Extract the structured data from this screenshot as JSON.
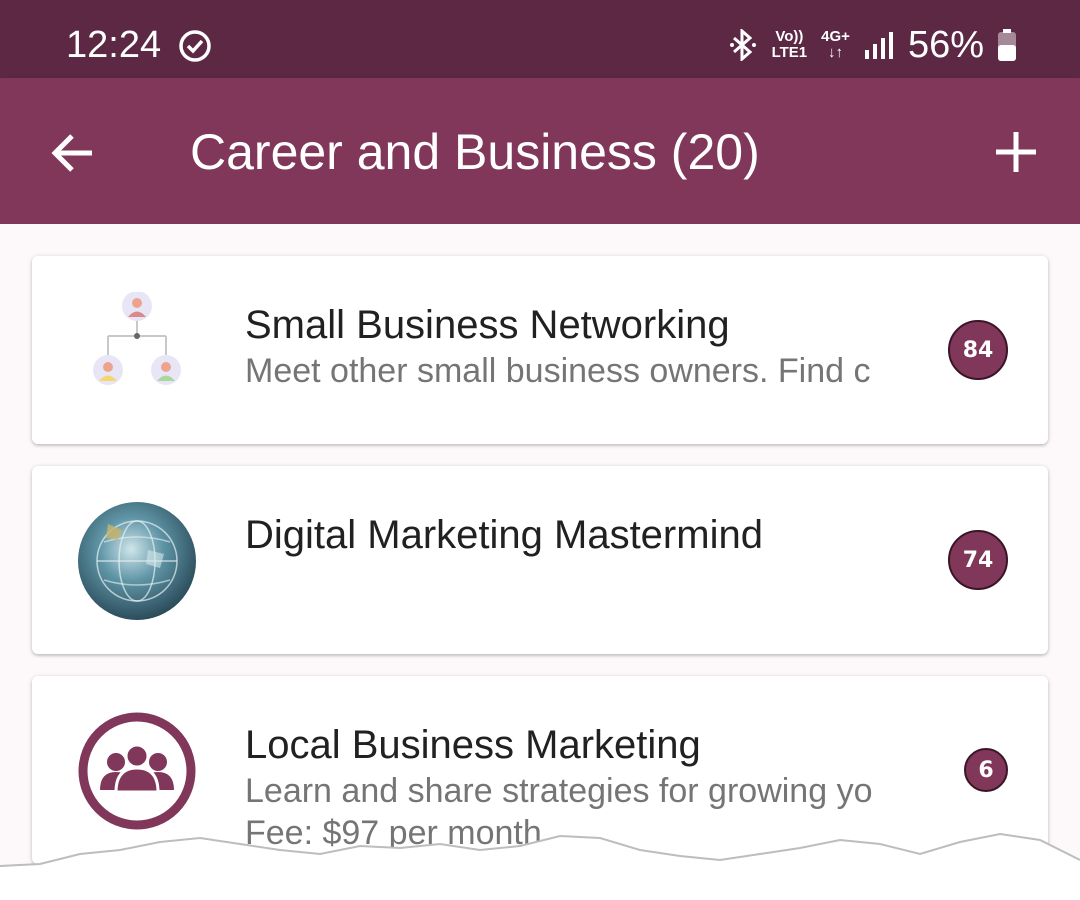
{
  "status_bar": {
    "time": "12:24",
    "network_top": "Vo))",
    "network_bottom": "LTE1",
    "network_type": "4G+",
    "battery": "56%",
    "icons": [
      "check-circle-icon",
      "bluetooth-icon",
      "signal-icon",
      "battery-icon"
    ]
  },
  "app_bar": {
    "title": "Career and Business (20)",
    "back_icon": "arrow-left-icon",
    "add_icon": "plus-icon",
    "background": "#81375a"
  },
  "groups": [
    {
      "title": "Small Business Networking",
      "description": "Meet other small business owners. Find c",
      "fee": "",
      "count": "84",
      "icon": "network-people-icon"
    },
    {
      "title": "Digital Marketing Mastermind",
      "description": "",
      "fee": "",
      "count": "74",
      "icon": "globe-image-icon"
    },
    {
      "title": "Local Business Marketing",
      "description": "Learn and share strategies for growing yo",
      "fee": "Fee: $97 per month",
      "count": "6",
      "icon": "group-users-icon"
    }
  ],
  "colors": {
    "status_bar": "#5c2844",
    "accent": "#81375a",
    "title_text": "#212121",
    "secondary_text": "#757575"
  }
}
